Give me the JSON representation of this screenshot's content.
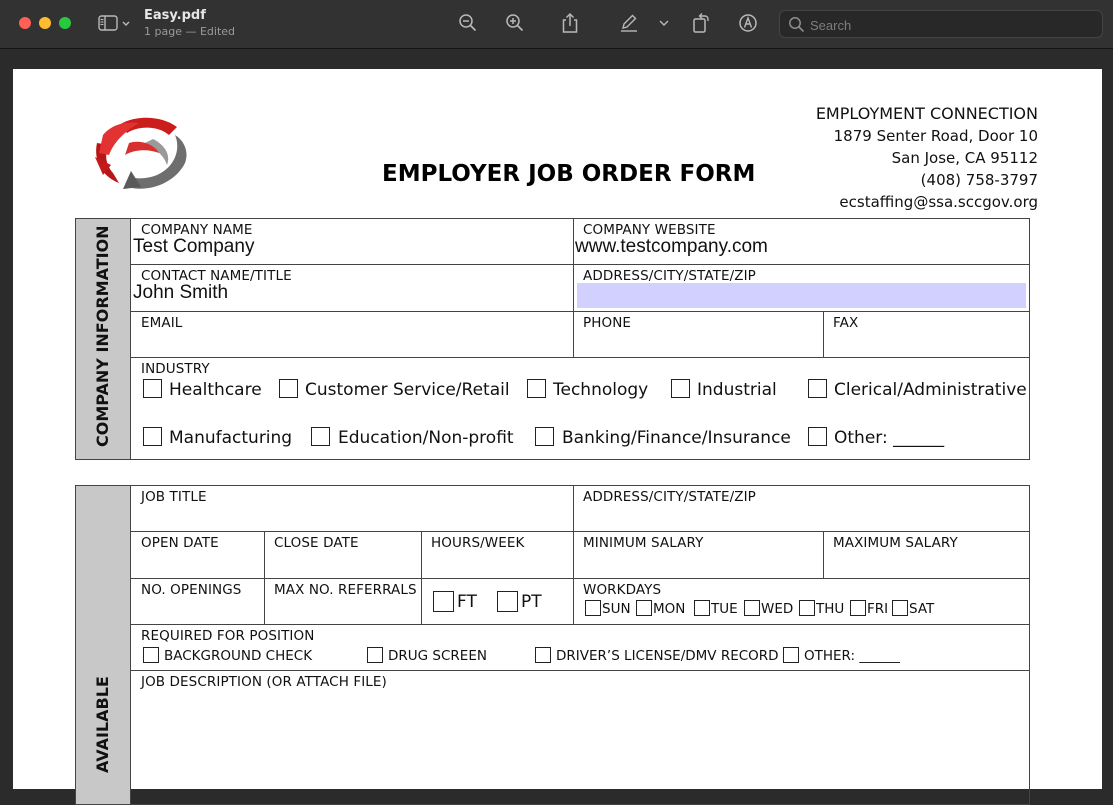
{
  "window": {
    "title": "Easy.pdf",
    "subtitle": "1 page — Edited",
    "search_placeholder": "Search"
  },
  "toolbar": {
    "icons": [
      "sidebar-toggle-icon",
      "chevron-down-icon",
      "zoom-out-icon",
      "zoom-in-icon",
      "share-icon",
      "markup-pen-icon",
      "chevron-down-icon",
      "rotate-icon",
      "annotate-icon",
      "search-icon"
    ]
  },
  "header": {
    "org": "EMPLOYMENT CONNECTION",
    "street": "1879 Senter Road, Door 10",
    "city": "San Jose, CA 95112",
    "phone": "(408) 758-3797",
    "email": "ecstaffing@ssa.sccgov.org",
    "form_title": "EMPLOYER JOB ORDER FORM"
  },
  "company_section": {
    "side_label": "COMPANY INFORMATION",
    "company_name_label": "COMPANY NAME",
    "company_name_value": "Test Company",
    "website_label": "COMPANY WEBSITE",
    "website_value": "www.testcompany.com",
    "contact_label": "CONTACT NAME/TITLE",
    "contact_value": "John Smith",
    "address_label": "ADDRESS/CITY/STATE/ZIP",
    "address_value": "",
    "email_label": "EMAIL",
    "phone_label": "PHONE",
    "fax_label": "FAX",
    "industry_label": "INDUSTRY",
    "industries": [
      "Healthcare",
      "Customer Service/Retail",
      "Technology",
      "Industrial",
      "Clerical/Administrative",
      "Manufacturing",
      "Education/Non-profit",
      "Banking/Finance/Insurance",
      "Other: ______"
    ]
  },
  "job_section": {
    "side_label": "AVAILABLE",
    "job_title_label": "JOB TITLE",
    "address_label": "ADDRESS/CITY/STATE/ZIP",
    "open_date_label": "OPEN DATE",
    "close_date_label": "CLOSE DATE",
    "hours_label": "HOURS/WEEK",
    "min_salary_label": "MINIMUM SALARY",
    "max_salary_label": "MAXIMUM SALARY",
    "openings_label": "NO. OPENINGS",
    "referrals_label": "MAX NO. REFERRALS",
    "ft_label": "FT",
    "pt_label": "PT",
    "workdays_label": "WORKDAYS",
    "workdays": [
      "SUN",
      "MON",
      "TUE",
      "WED",
      "THU",
      "FRI",
      "SAT"
    ],
    "required_label": "REQUIRED FOR POSITION",
    "required": [
      "BACKGROUND CHECK",
      "DRUG SCREEN",
      "DRIVER’S LICENSE/DMV RECORD",
      "OTHER: ______"
    ],
    "description_label": "JOB DESCRIPTION (OR ATTACH FILE)"
  },
  "colors": {
    "highlight_field": "#d2d0ff",
    "sidebar": "#c8c8c8"
  }
}
